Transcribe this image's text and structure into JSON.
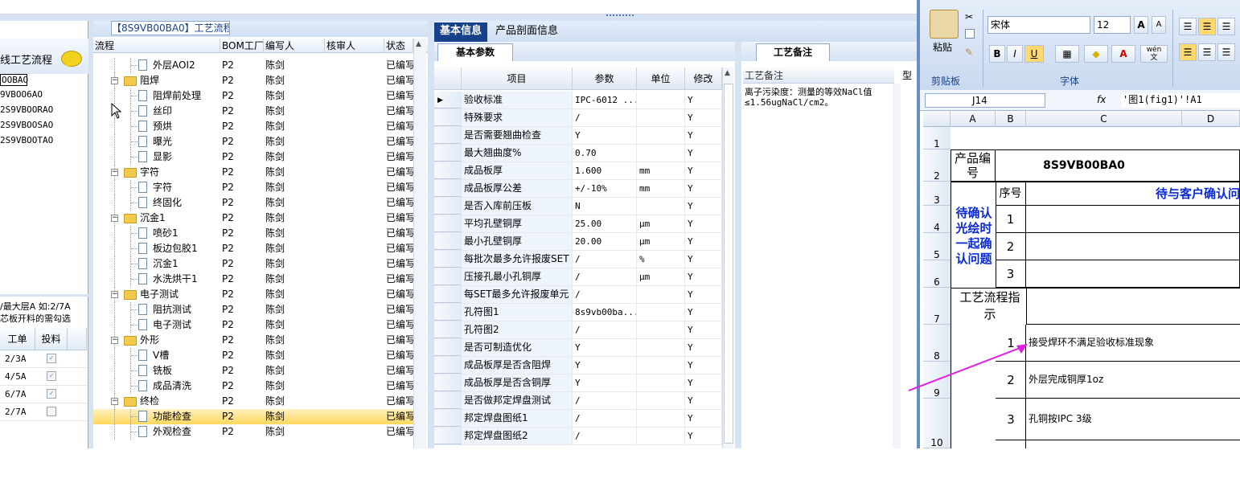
{
  "left_panel": {
    "title": "线工艺流程",
    "items": [
      "OOBAO",
      "9VBOO6AO",
      "2S9VBOORAO",
      "2S9VBOOSAO",
      "2S9VBOOTAO"
    ],
    "note_line1": "/最大层A 如:2/7A",
    "note_line2": "芯板开料的需勾选",
    "table_headers": [
      "工单",
      "投料"
    ],
    "rows": [
      {
        "layer": "2/3A",
        "checked": true
      },
      {
        "layer": "4/5A",
        "checked": true
      },
      {
        "layer": "6/7A",
        "checked": true
      },
      {
        "layer": "2/7A",
        "checked": false
      }
    ]
  },
  "tree": {
    "title": "【8S9VB00BA0】工艺流程",
    "headers": [
      "流程",
      "BOM工厂",
      "编写人",
      "核审人",
      "状态"
    ],
    "rows": [
      {
        "type": "leaf",
        "name": "外层AOI2",
        "bom": "P2",
        "writer": "陈剑",
        "reviewer": "",
        "status": "已编写"
      },
      {
        "type": "folder",
        "name": "阻焊",
        "bom": "P2",
        "writer": "陈剑",
        "reviewer": "",
        "status": "已编写"
      },
      {
        "type": "leaf",
        "name": "阻焊前处理",
        "bom": "P2",
        "writer": "陈剑",
        "reviewer": "",
        "status": "已编写"
      },
      {
        "type": "leaf",
        "name": "丝印",
        "bom": "P2",
        "writer": "陈剑",
        "reviewer": "",
        "status": "已编写"
      },
      {
        "type": "leaf",
        "name": "预烘",
        "bom": "P2",
        "writer": "陈剑",
        "reviewer": "",
        "status": "已编写"
      },
      {
        "type": "leaf",
        "name": "曝光",
        "bom": "P2",
        "writer": "陈剑",
        "reviewer": "",
        "status": "已编写"
      },
      {
        "type": "leaf",
        "name": "显影",
        "bom": "P2",
        "writer": "陈剑",
        "reviewer": "",
        "status": "已编写"
      },
      {
        "type": "folder",
        "name": "字符",
        "bom": "P2",
        "writer": "陈剑",
        "reviewer": "",
        "status": "已编写"
      },
      {
        "type": "leaf",
        "name": "字符",
        "bom": "P2",
        "writer": "陈剑",
        "reviewer": "",
        "status": "已编写"
      },
      {
        "type": "leaf",
        "name": "终固化",
        "bom": "P2",
        "writer": "陈剑",
        "reviewer": "",
        "status": "已编写"
      },
      {
        "type": "folder",
        "name": "沉金1",
        "bom": "P2",
        "writer": "陈剑",
        "reviewer": "",
        "status": "已编写"
      },
      {
        "type": "leaf",
        "name": "喷砂1",
        "bom": "P2",
        "writer": "陈剑",
        "reviewer": "",
        "status": "已编写"
      },
      {
        "type": "leaf",
        "name": "板边包胶1",
        "bom": "P2",
        "writer": "陈剑",
        "reviewer": "",
        "status": "已编写"
      },
      {
        "type": "leaf",
        "name": "沉金1",
        "bom": "P2",
        "writer": "陈剑",
        "reviewer": "",
        "status": "已编写"
      },
      {
        "type": "leaf",
        "name": "水洗烘干1",
        "bom": "P2",
        "writer": "陈剑",
        "reviewer": "",
        "status": "已编写"
      },
      {
        "type": "folder",
        "name": "电子测试",
        "bom": "P2",
        "writer": "陈剑",
        "reviewer": "",
        "status": "已编写"
      },
      {
        "type": "leaf",
        "name": "阻抗测试",
        "bom": "P2",
        "writer": "陈剑",
        "reviewer": "",
        "status": "已编写"
      },
      {
        "type": "leaf",
        "name": "电子测试",
        "bom": "P2",
        "writer": "陈剑",
        "reviewer": "",
        "status": "已编写"
      },
      {
        "type": "folder",
        "name": "外形",
        "bom": "P2",
        "writer": "陈剑",
        "reviewer": "",
        "status": "已编写"
      },
      {
        "type": "leaf",
        "name": "V槽",
        "bom": "P2",
        "writer": "陈剑",
        "reviewer": "",
        "status": "已编写"
      },
      {
        "type": "leaf",
        "name": "铣板",
        "bom": "P2",
        "writer": "陈剑",
        "reviewer": "",
        "status": "已编写"
      },
      {
        "type": "leaf",
        "name": "成品清洗",
        "bom": "P2",
        "writer": "陈剑",
        "reviewer": "",
        "status": "已编写"
      },
      {
        "type": "folder",
        "name": "终检",
        "bom": "P2",
        "writer": "陈剑",
        "reviewer": "",
        "status": "已编写"
      },
      {
        "type": "leaf",
        "name": "功能检查",
        "bom": "P2",
        "writer": "陈剑",
        "reviewer": "",
        "status": "已编写",
        "selected": true
      },
      {
        "type": "leaf",
        "name": "外观检查",
        "bom": "P2",
        "writer": "陈剑",
        "reviewer": "",
        "status": "已编写"
      }
    ]
  },
  "middle": {
    "tabs": [
      "基本信息",
      "产品剖面信息"
    ],
    "param_tab": "基本参数",
    "headers": [
      "项目",
      "参数",
      "单位",
      "修改"
    ],
    "rows": [
      {
        "item": "验收标准",
        "param": "IPC-6012 ...",
        "unit": "",
        "mod": "Y"
      },
      {
        "item": "特殊要求",
        "param": "/",
        "unit": "",
        "mod": "Y"
      },
      {
        "item": "是否需要翘曲检查",
        "param": "Y",
        "unit": "",
        "mod": "Y"
      },
      {
        "item": "最大翘曲度%",
        "param": "0.70",
        "unit": "",
        "mod": "Y"
      },
      {
        "item": "成品板厚",
        "param": "1.600",
        "unit": "mm",
        "mod": "Y"
      },
      {
        "item": "成品板厚公差",
        "param": "+/-10%",
        "unit": "mm",
        "mod": "Y"
      },
      {
        "item": "是否入库前压板",
        "param": "N",
        "unit": "",
        "mod": "Y"
      },
      {
        "item": "平均孔壁铜厚",
        "param": "25.00",
        "unit": "μm",
        "mod": "Y"
      },
      {
        "item": "最小孔壁铜厚",
        "param": "20.00",
        "unit": "μm",
        "mod": "Y"
      },
      {
        "item": "每批次最多允许报废SET",
        "param": "/",
        "unit": "%",
        "mod": "Y"
      },
      {
        "item": "压接孔最小孔铜厚",
        "param": "/",
        "unit": "μm",
        "mod": "Y"
      },
      {
        "item": "每SET最多允许报废单元",
        "param": "/",
        "unit": "",
        "mod": "Y"
      },
      {
        "item": "孔符图1",
        "param": "8s9vb00ba...",
        "unit": "",
        "mod": "Y"
      },
      {
        "item": "孔符图2",
        "param": "/",
        "unit": "",
        "mod": "Y"
      },
      {
        "item": "是否可制造优化",
        "param": "Y",
        "unit": "",
        "mod": "Y"
      },
      {
        "item": "成品板厚是否含阻焊",
        "param": "Y",
        "unit": "",
        "mod": "Y"
      },
      {
        "item": "成品板厚是否含铜厚",
        "param": "Y",
        "unit": "",
        "mod": "Y"
      },
      {
        "item": "是否做邦定焊盘测试",
        "param": "/",
        "unit": "",
        "mod": "Y"
      },
      {
        "item": "邦定焊盘图纸1",
        "param": "/",
        "unit": "",
        "mod": "Y"
      },
      {
        "item": "邦定焊盘图纸2",
        "param": "/",
        "unit": "",
        "mod": "Y"
      }
    ]
  },
  "notes": {
    "tab": "工艺备注",
    "header": "工艺备注",
    "type_label": "型",
    "text": "离子污染度：测量的等效NaCl值≤1.56ugNaCl/cm2。"
  },
  "excel": {
    "paste": "粘贴",
    "clipboard": "剪贴板",
    "font_group": "字体",
    "font_name": "宋体",
    "font_size": "12",
    "bold": "B",
    "italic": "I",
    "underline": "U",
    "font_color": "A",
    "wen": "wén\n文",
    "grow_font": "A",
    "shrink_font": "A",
    "name_box": "J14",
    "fx": "fx",
    "formula": "'图1(fig1)'!A1",
    "col_headers": [
      "A",
      "B",
      "C",
      "D"
    ],
    "row_headers": [
      "1",
      "2",
      "3",
      "4",
      "5",
      "6",
      "7",
      "8",
      "9",
      "10"
    ],
    "product_no_label": "产品编号",
    "product_no": "8S9VB00BA0",
    "seq_label": "序号",
    "pending_label": "待与客户确认问",
    "pending_side": "待确认光绘时一起确认问题",
    "seq": [
      "1",
      "2",
      "3"
    ],
    "flow_label": "工艺流程指示",
    "flow_items": [
      {
        "no": "1",
        "text": "接受焊环不满足验收标准现象"
      },
      {
        "no": "2",
        "text": "外层完成铜厚1oz"
      },
      {
        "no": "3",
        "text": "孔铜按IPC 3级"
      }
    ]
  }
}
